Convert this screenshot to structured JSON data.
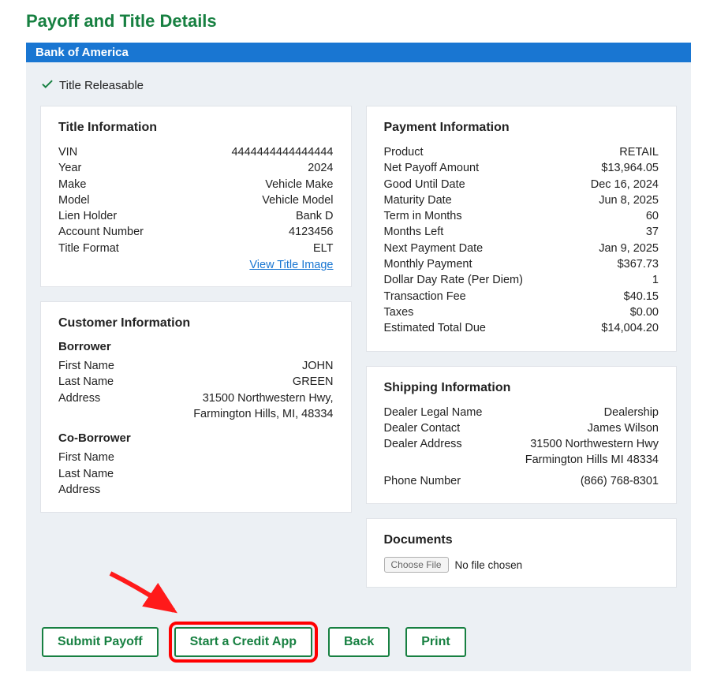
{
  "page": {
    "title": "Payoff and Title Details",
    "bank": "Bank of America",
    "status": "Title Releasable"
  },
  "titleInfo": {
    "heading": "Title Information",
    "vin_label": "VIN",
    "vin": "4444444444444444",
    "year_label": "Year",
    "year": "2024",
    "make_label": "Make",
    "make": "Vehicle Make",
    "model_label": "Model",
    "model": "Vehicle Model",
    "lienholder_label": "Lien Holder",
    "lienholder": "Bank D",
    "account_label": "Account Number",
    "account": "4123456",
    "format_label": "Title Format",
    "format": "ELT",
    "viewTitle": "View Title Image"
  },
  "customerInfo": {
    "heading": "Customer Information",
    "borrower_heading": "Borrower",
    "coborrower_heading": "Co-Borrower",
    "firstName_label": "First Name",
    "lastName_label": "Last Name",
    "address_label": "Address",
    "borrower": {
      "firstName": "JOHN",
      "lastName": "GREEN",
      "address": "31500 Northwestern Hwy, Farmington Hills, MI, 48334"
    },
    "coborrower": {
      "firstName": "",
      "lastName": "",
      "address": ""
    }
  },
  "paymentInfo": {
    "heading": "Payment Information",
    "product_label": "Product",
    "product": "RETAIL",
    "netPayoff_label": "Net Payoff Amount",
    "netPayoff": "$13,964.05",
    "goodUntil_label": "Good Until Date",
    "goodUntil": "Dec 16, 2024",
    "maturity_label": "Maturity Date",
    "maturity": "Jun 8, 2025",
    "term_label": "Term in Months",
    "term": "60",
    "monthsLeft_label": "Months Left",
    "monthsLeft": "37",
    "nextPayment_label": "Next Payment Date",
    "nextPayment": "Jan 9, 2025",
    "monthlyPayment_label": "Monthly Payment",
    "monthlyPayment": "$367.73",
    "perDiem_label": "Dollar Day Rate (Per Diem)",
    "perDiem": "1",
    "transactionFee_label": "Transaction Fee",
    "transactionFee": "$40.15",
    "taxes_label": "Taxes",
    "taxes": "$0.00",
    "totalDue_label": "Estimated Total Due",
    "totalDue": "$14,004.20"
  },
  "shippingInfo": {
    "heading": "Shipping Information",
    "dealerName_label": "Dealer Legal Name",
    "dealerName": "Dealership",
    "dealerContact_label": "Dealer Contact",
    "dealerContact": "James Wilson",
    "dealerAddress_label": "Dealer Address",
    "dealerAddress": "31500 Northwestern Hwy Farmington Hills MI 48334",
    "phone_label": "Phone Number",
    "phone": "(866) 768-8301"
  },
  "documents": {
    "heading": "Documents",
    "chooseFile": "Choose File",
    "noFile": "No file chosen"
  },
  "buttons": {
    "submitPayoff": "Submit Payoff",
    "startCreditApp": "Start a Credit App",
    "back": "Back",
    "print": "Print"
  }
}
